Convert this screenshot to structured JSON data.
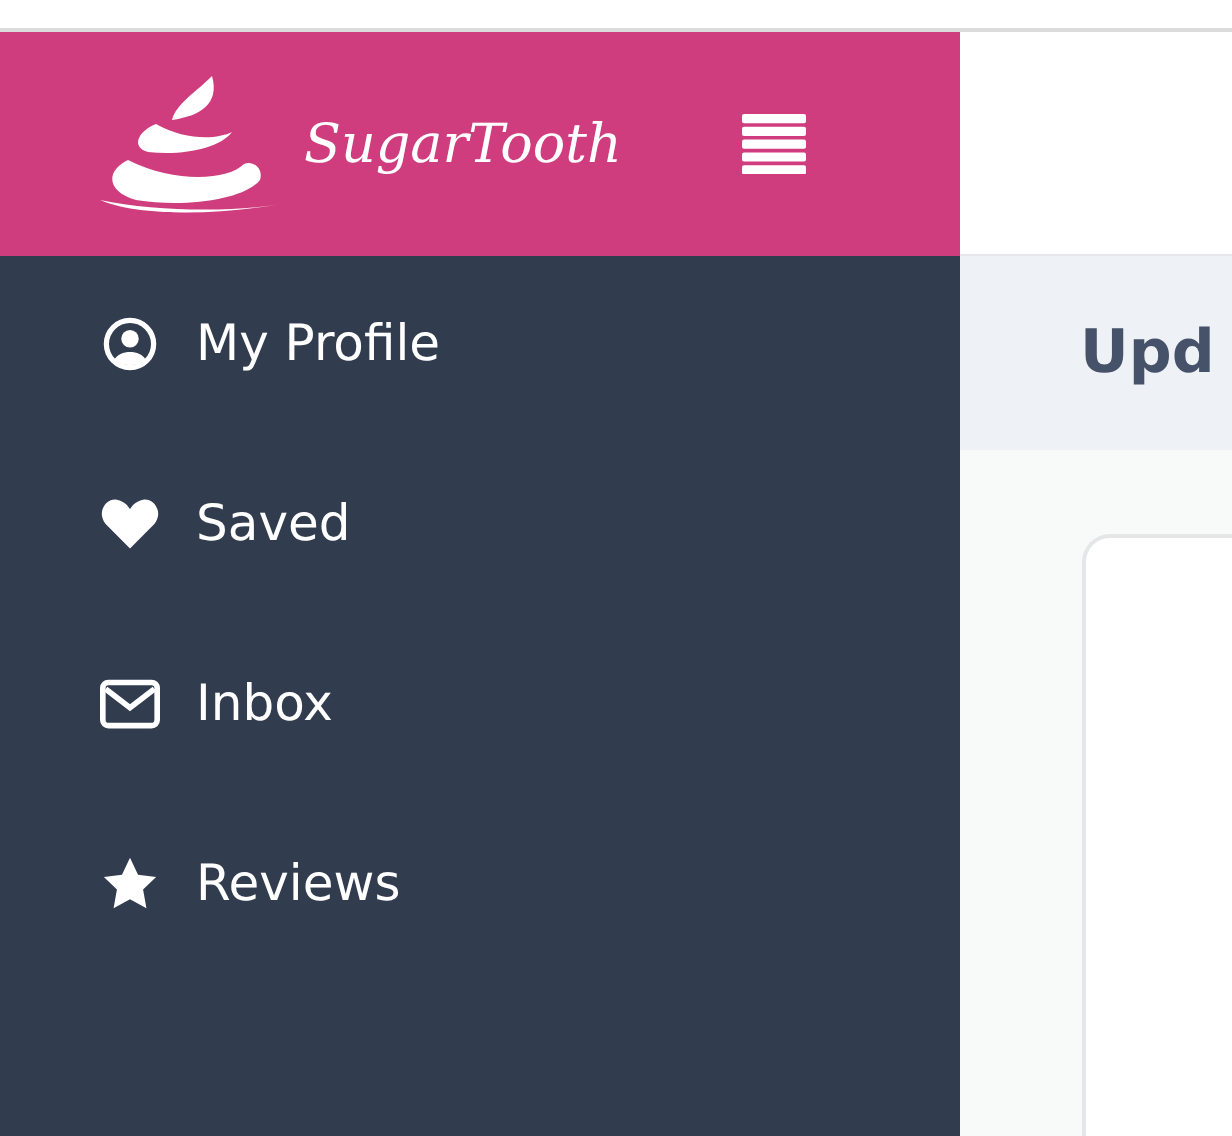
{
  "header": {
    "logo_text": "SugarTooth"
  },
  "sidebar": {
    "items": [
      {
        "kind": "profile",
        "label": "My Profile"
      },
      {
        "kind": "heart",
        "label": "Saved"
      },
      {
        "kind": "mail",
        "label": "Inbox"
      },
      {
        "kind": "star",
        "label": "Reviews"
      }
    ]
  },
  "main": {
    "heading": "Upd"
  }
}
